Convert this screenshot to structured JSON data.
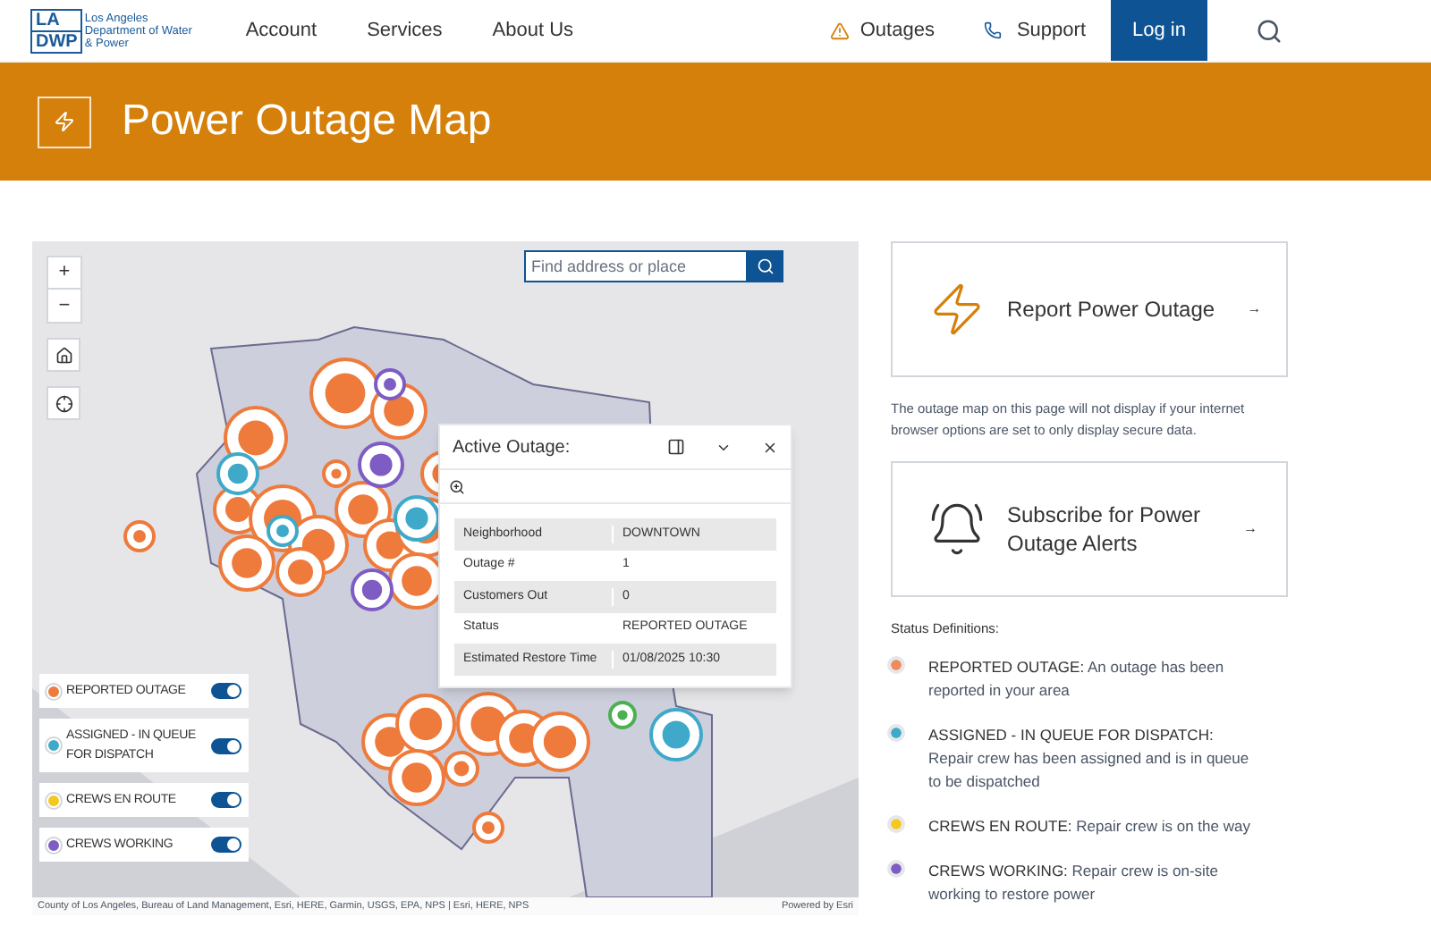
{
  "header": {
    "logo_top": "LA",
    "logo_bottom": "DWP",
    "logo_name": "Los Angeles Department of Water & Power",
    "nav": [
      "Account",
      "Services",
      "About Us"
    ],
    "outages": "Outages",
    "support": "Support",
    "login": "Log in"
  },
  "banner": {
    "title": "Power Outage Map"
  },
  "map": {
    "search": {
      "placeholder": "Find address or place"
    },
    "zoom_in": "+",
    "zoom_out": "−",
    "popup": {
      "title": "Active Outage:",
      "rows": [
        {
          "label": "Neighborhood",
          "value": "DOWNTOWN"
        },
        {
          "label": "Outage #",
          "value": "1"
        },
        {
          "label": "Customers Out",
          "value": "0"
        },
        {
          "label": "Status",
          "value": "REPORTED OUTAGE"
        },
        {
          "label": "Estimated Restore Time",
          "value": "01/08/2025 10:30"
        }
      ]
    },
    "legend": [
      {
        "label": "REPORTED OUTAGE",
        "color": "#ee7a3b",
        "on": true
      },
      {
        "label": "ASSIGNED - IN QUEUE FOR DISPATCH",
        "color": "#3fa9c9",
        "on": true
      },
      {
        "label": "CREWS EN ROUTE",
        "color": "#f4c81e",
        "on": true
      },
      {
        "label": "CREWS WORKING",
        "color": "#7d5cc4",
        "on": true
      }
    ],
    "attribution": "County of Los Angeles, Bureau of Land Management, Esri, HERE, Garmin, USGS, EPA, NPS | Esri, HERE, NPS",
    "powered": "Powered by Esri"
  },
  "report_card": {
    "title": "Report Power Outage",
    "arrow": "→"
  },
  "notice": "The outage map on this page will not display if your internet browser options are set to only display secure data.",
  "subscribe_card": {
    "title": "Subscribe for Power Outage Alerts",
    "arrow": "→"
  },
  "status_heading": "Status Definitions:",
  "statuses": [
    {
      "term": "REPORTED OUTAGE:",
      "text": "An outage has been reported in your area",
      "color": "#ee8a5c"
    },
    {
      "term": "ASSIGNED - IN QUEUE FOR DISPATCH:",
      "text": "Repair crew has been assigned and is in queue to be dispatched",
      "color": "#3fa9c9"
    },
    {
      "term": "CREWS EN ROUTE:",
      "text": "Repair crew is on the way",
      "color": "#f4c81e"
    },
    {
      "term": "CREWS WORKING:",
      "text": "Repair crew is on-site working to restore power",
      "color": "#7d5cc4"
    }
  ]
}
